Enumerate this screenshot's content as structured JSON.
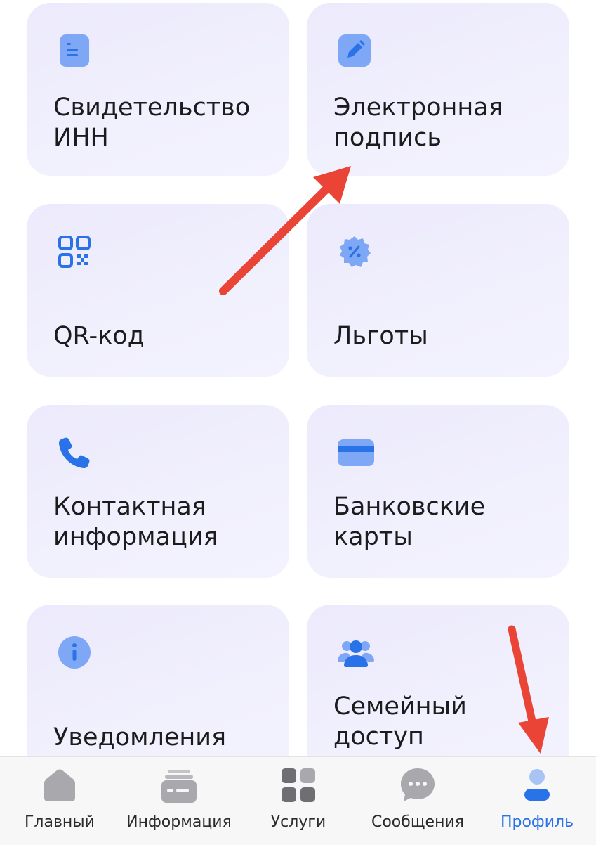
{
  "tiles": [
    {
      "label": "Свидетельство ИНН",
      "icon": "document-icon"
    },
    {
      "label": "Электронная подпись",
      "icon": "pencil-icon"
    },
    {
      "label": "QR-код",
      "icon": "qr-code-icon"
    },
    {
      "label": "Льготы",
      "icon": "discount-badge-icon"
    },
    {
      "label": "Контактная информация",
      "icon": "phone-icon"
    },
    {
      "label": "Банковские карты",
      "icon": "bank-card-icon"
    },
    {
      "label": "Уведомления",
      "icon": "info-icon"
    },
    {
      "label": "Семейный доступ",
      "icon": "family-icon"
    }
  ],
  "tabbar": {
    "active": "Профиль",
    "items": [
      {
        "label": "Главный",
        "icon": "home-icon"
      },
      {
        "label": "Информация",
        "icon": "id-card-icon"
      },
      {
        "label": "Услуги",
        "icon": "grid-icon"
      },
      {
        "label": "Сообщения",
        "icon": "chat-icon"
      },
      {
        "label": "Профиль",
        "icon": "profile-icon"
      }
    ]
  },
  "colors": {
    "accent": "#2a72e8",
    "icon_light": "#7ea8f5",
    "annotation_arrow": "#e94435",
    "tile_bg": "#efeefc"
  }
}
